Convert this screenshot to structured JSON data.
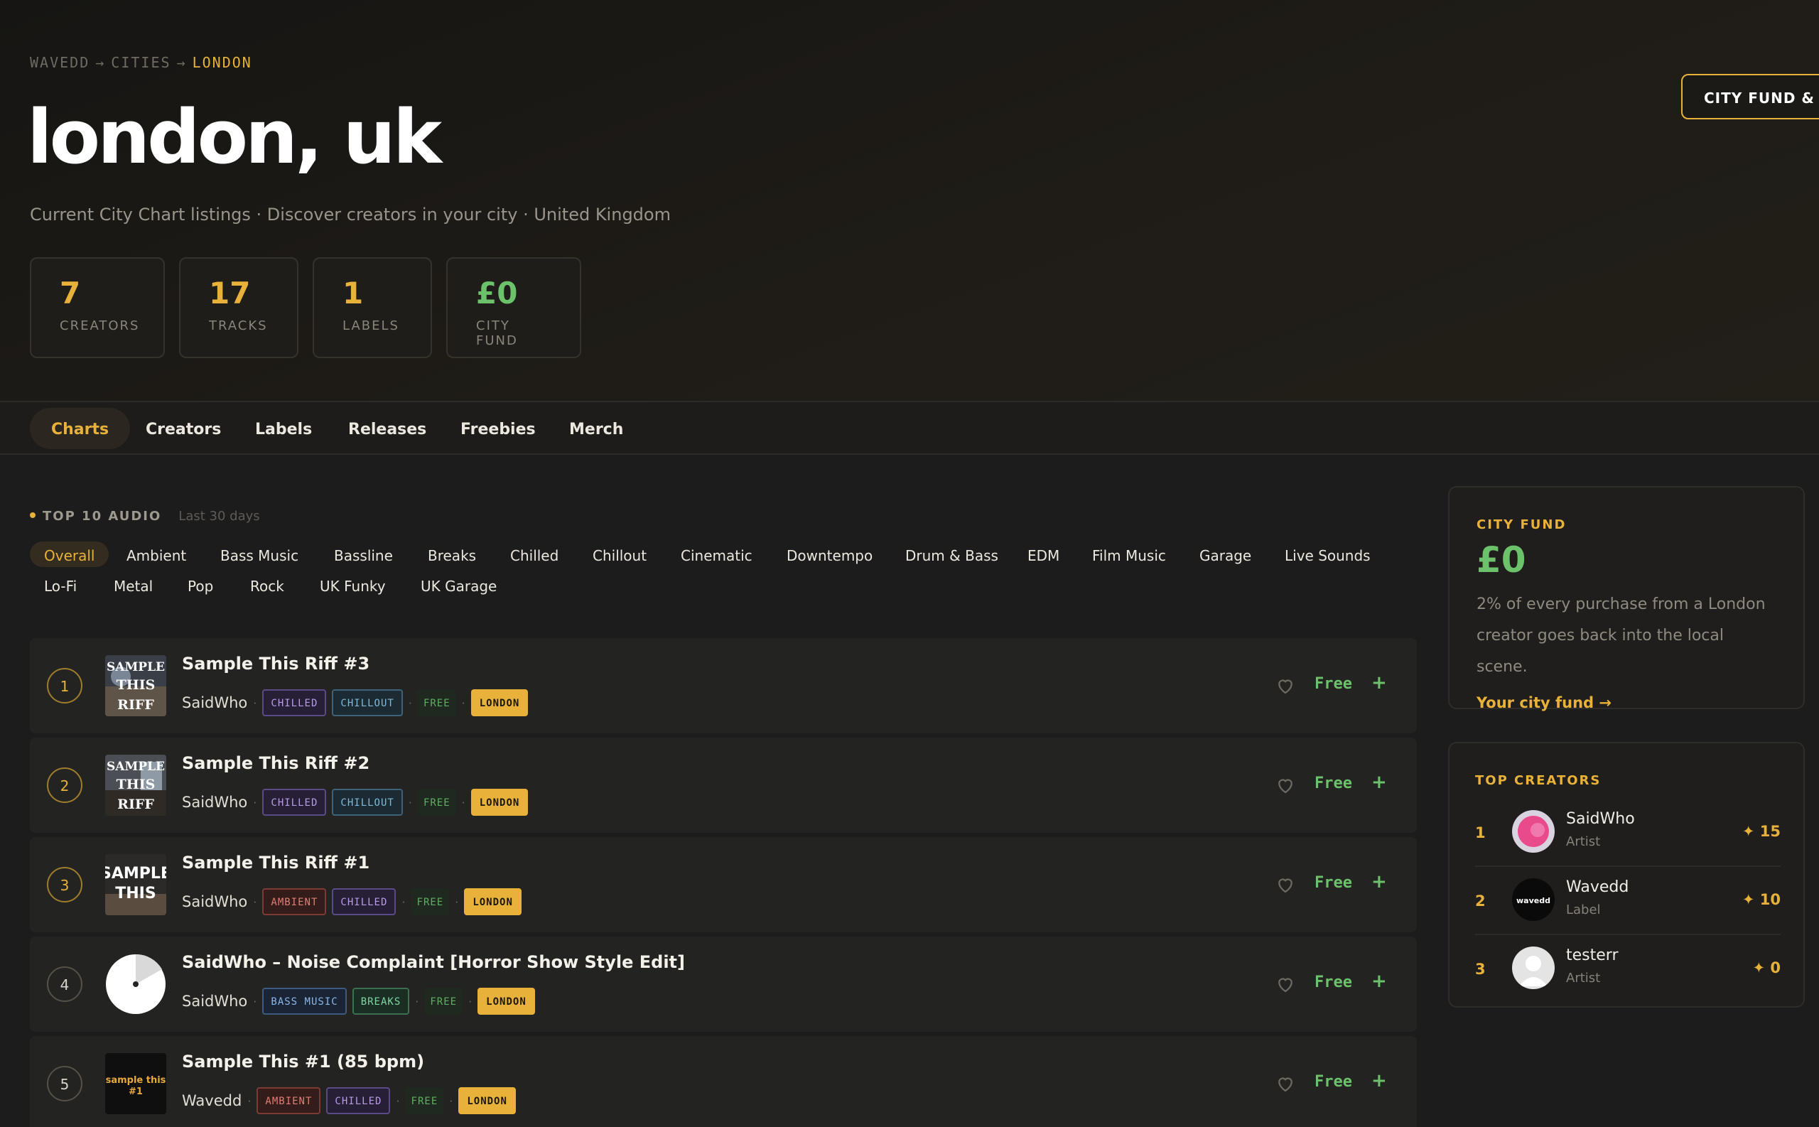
{
  "breadcrumb": {
    "root": "WAVEDD",
    "arrow1": "→",
    "mid": "CITIES",
    "arrow2": "→",
    "current": "LONDON"
  },
  "page": {
    "title": "london, uk",
    "subtitle": "Current City Chart listings · Discover creators in your city · United Kingdom",
    "fund_button": "CITY FUND & VO"
  },
  "stats": [
    {
      "value": "7",
      "label": "CREATORS"
    },
    {
      "value": "17",
      "label": "TRACKS"
    },
    {
      "value": "1",
      "label": "LABELS"
    },
    {
      "value": "£0",
      "label": "CITY FUND"
    }
  ],
  "tabs": [
    "Charts",
    "Creators",
    "Labels",
    "Releases",
    "Freebies",
    "Merch"
  ],
  "active_tab": "Charts",
  "section": {
    "label": "TOP 10 AUDIO",
    "sub": "Last 30 days"
  },
  "genres": [
    "Overall",
    "Ambient",
    "Bass Music",
    "Bassline",
    "Breaks",
    "Chilled",
    "Chillout",
    "Cinematic",
    "Downtempo",
    "Drum & Bass",
    "EDM",
    "Film Music",
    "Garage",
    "Live Sounds",
    "Lo-Fi",
    "Metal",
    "Pop",
    "Rock",
    "UK Funky",
    "UK Garage"
  ],
  "active_genre": "Overall",
  "tracks": [
    {
      "rank": "1",
      "title": "Sample This Riff #3",
      "artist": "SaidWho",
      "tags": [
        "CHILLED",
        "CHILLOUT"
      ],
      "free_tag": "FREE",
      "city_tag": "LONDON",
      "price": "Free",
      "add": "+",
      "art_text": [
        "SAMPLE",
        "THIS",
        "RIFF"
      ]
    },
    {
      "rank": "2",
      "title": "Sample This Riff #2",
      "artist": "SaidWho",
      "tags": [
        "CHILLED",
        "CHILLOUT"
      ],
      "free_tag": "FREE",
      "city_tag": "LONDON",
      "price": "Free",
      "add": "+",
      "art_text": [
        "SAMPLE",
        "THIS",
        "RIFF"
      ]
    },
    {
      "rank": "3",
      "title": "Sample This Riff #1",
      "artist": "SaidWho",
      "tags": [
        "AMBIENT",
        "CHILLED"
      ],
      "free_tag": "FREE",
      "city_tag": "LONDON",
      "price": "Free",
      "add": "+",
      "art_text": [
        "SAMPLE",
        "THIS"
      ]
    },
    {
      "rank": "4",
      "title": "SaidWho – Noise Complaint [Horror Show Style Edit]",
      "artist": "SaidWho",
      "tags": [
        "BASS MUSIC",
        "BREAKS"
      ],
      "free_tag": "FREE",
      "city_tag": "LONDON",
      "price": "Free",
      "add": "+"
    },
    {
      "rank": "5",
      "title": "Sample This #1 (85 bpm)",
      "artist": "Wavedd",
      "tags": [
        "AMBIENT",
        "CHILLED"
      ],
      "free_tag": "FREE",
      "city_tag": "LONDON",
      "price": "Free",
      "add": "+",
      "art_text": [
        "sample this",
        "#1"
      ]
    }
  ],
  "city_fund": {
    "title": "CITY FUND",
    "value": "£0",
    "text": "2% of every purchase from a London creator goes back into the local scene.",
    "link": "Your city fund →"
  },
  "top_creators": {
    "title": "TOP CREATORS",
    "items": [
      {
        "rank": "1",
        "name": "SaidWho",
        "role": "Artist",
        "score": "✦ 15"
      },
      {
        "rank": "2",
        "name": "Wavedd",
        "role": "Label",
        "score": "✦ 10",
        "avatar_text": "wavedd"
      },
      {
        "rank": "3",
        "name": "testerr",
        "role": "Artist",
        "score": "✦ 0"
      }
    ]
  },
  "colors": {
    "accent": "#e8b23a",
    "green": "#6cc26a",
    "background": "#1c1c1c"
  }
}
